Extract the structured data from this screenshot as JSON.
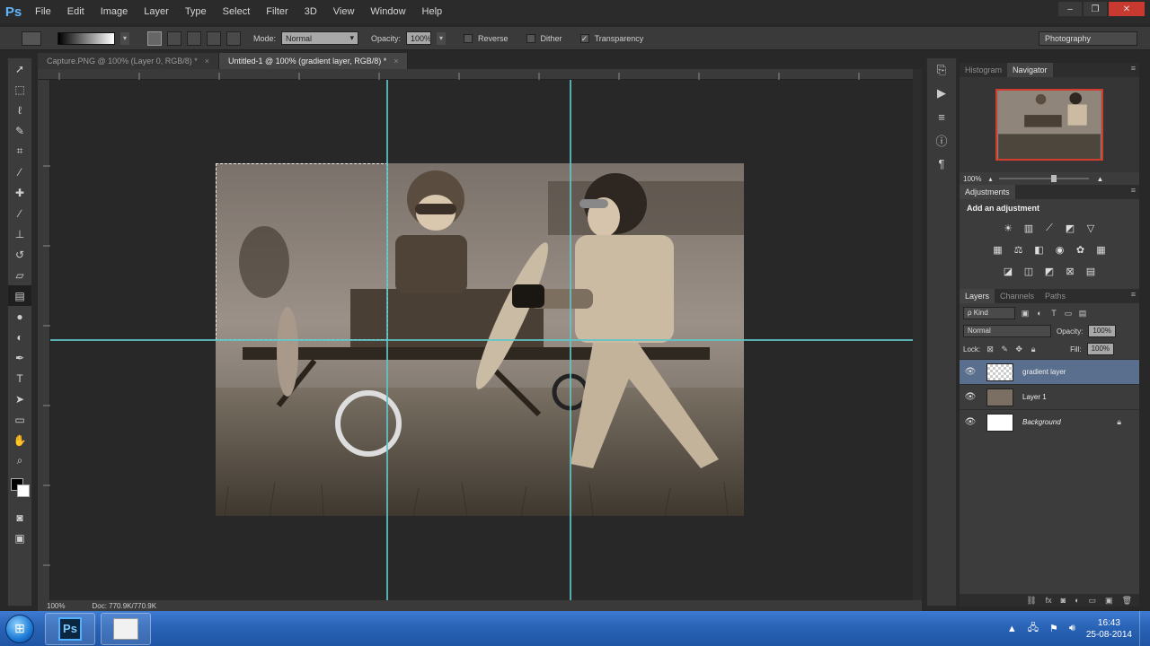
{
  "app": {
    "logo": "Ps"
  },
  "menu": [
    "File",
    "Edit",
    "Image",
    "Layer",
    "Type",
    "Select",
    "Filter",
    "3D",
    "View",
    "Window",
    "Help"
  ],
  "window_controls": {
    "minimize": "–",
    "restore": "❐",
    "close": "✕"
  },
  "options_bar": {
    "mode_label": "Mode:",
    "mode_value": "Normal",
    "opacity_label": "Opacity:",
    "opacity_value": "100%",
    "reverse_label": "Reverse",
    "dither_label": "Dither",
    "transparency_label": "Transparency",
    "transparency_checked": "✓",
    "workspace": "Photography"
  },
  "tabs": [
    {
      "label": "Capture.PNG @ 100% (Layer 0, RGB/8) *"
    },
    {
      "label": "Untitled-1 @ 100% (gradient layer, RGB/8) *"
    }
  ],
  "tab_close": "×",
  "status": {
    "zoom": "100%",
    "doc": "Doc: 770.9K/770.9K"
  },
  "panels": {
    "top_tabs": [
      "Histogram",
      "Navigator"
    ],
    "navigator_zoom": "100%",
    "adjustments_tab": "Adjustments",
    "adjustments_title": "Add an adjustment",
    "layers_tabs": [
      "Layers",
      "Channels",
      "Paths"
    ],
    "kind_label": "ρ Kind",
    "blend_mode": "Normal",
    "opacity_label": "Opacity:",
    "opacity_value": "100%",
    "lock_label": "Lock:",
    "fill_label": "Fill:",
    "fill_value": "100%"
  },
  "layers": [
    {
      "name": "gradient layer",
      "active": true
    },
    {
      "name": "Layer 1",
      "active": false
    },
    {
      "name": "Background",
      "active": false
    }
  ],
  "taskbar": {
    "ps_icon": "Ps",
    "time": "16:43",
    "date": "25-08-2014"
  },
  "colors": {
    "accent_guide": "#5ec5c9",
    "nav_frame": "#d23c2c",
    "active_layer": "#5a6f8d"
  }
}
